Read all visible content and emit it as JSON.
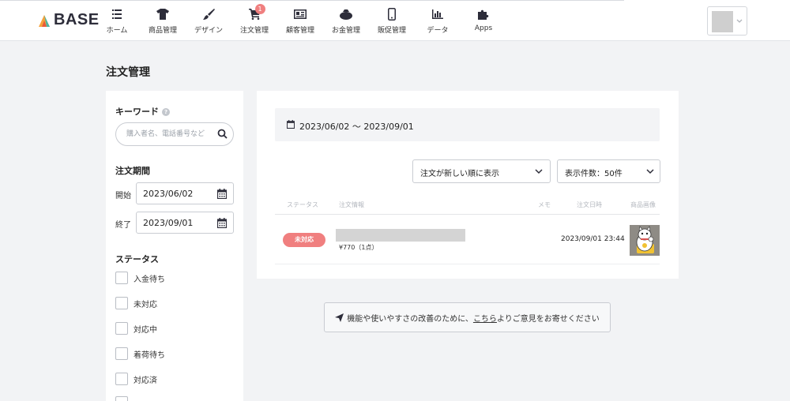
{
  "header": {
    "logo_text": "BASE",
    "nav": [
      {
        "label": "ホーム",
        "icon": "list-icon"
      },
      {
        "label": "商品管理",
        "icon": "tshirt-icon"
      },
      {
        "label": "デザイン",
        "icon": "paintbrush-icon"
      },
      {
        "label": "注文管理",
        "icon": "cart-icon",
        "badge": "1"
      },
      {
        "label": "顧客管理",
        "icon": "id-card-icon"
      },
      {
        "label": "お金管理",
        "icon": "wallet-icon"
      },
      {
        "label": "販促管理",
        "icon": "smartphone-icon"
      },
      {
        "label": "データ",
        "icon": "bar-chart-icon"
      },
      {
        "label": "Apps",
        "icon": "puzzle-icon"
      }
    ]
  },
  "page": {
    "title": "注文管理"
  },
  "sidebar": {
    "keyword_heading": "キーワード",
    "search_placeholder": "購入者名、電話番号など",
    "period_heading": "注文期間",
    "start_label": "開始",
    "start_value": "2023/06/02",
    "end_label": "終了",
    "end_value": "2023/09/01",
    "status_heading": "ステータス",
    "statuses": [
      "入金待ち",
      "未対応",
      "対応中",
      "着荷待ち",
      "対応済"
    ]
  },
  "main": {
    "date_range": "2023/06/02 〜 2023/09/01",
    "sort_select": "注文が新しい順に表示",
    "count_select": "表示件数：50件",
    "columns": [
      "ステータス",
      "注文情報",
      "メモ",
      "注文日時",
      "商品画像"
    ],
    "orders": [
      {
        "status": "未対応",
        "price": "¥770（1点）",
        "date": "2023/09/01 23:44"
      }
    ]
  },
  "feedback": {
    "prefix": "機能や使いやすさの改善のために、",
    "link": "こちら",
    "suffix": "よりご意見をお寄せください"
  },
  "colors": {
    "accent_badge": "#f07f7f",
    "background": "#f2f3f5"
  }
}
